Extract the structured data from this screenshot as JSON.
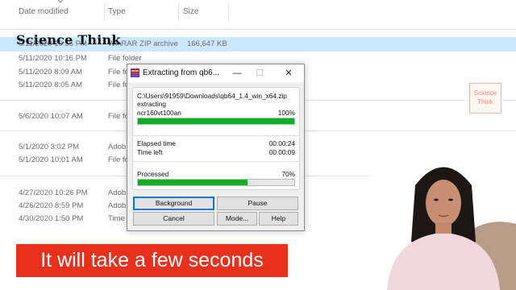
{
  "explorer": {
    "columns": {
      "date": "Date modified",
      "type": "Type",
      "size": "Size"
    },
    "rows": [
      {
        "date": "5/11/2020 10:55 PM",
        "type": "WinRAR ZIP archive",
        "size": "166,647 KB",
        "selected": true
      },
      {
        "date": "5/11/2020 10:16 PM",
        "type": "File folder",
        "size": ""
      },
      {
        "date": "5/11/2020 8:09 AM",
        "type": "File fo",
        "size": ""
      },
      {
        "date": "5/11/2020 8:05 AM",
        "type": "File fo",
        "size": ""
      },
      {
        "date": "5/6/2020 10:07 AM",
        "type": "File fo",
        "size": ""
      },
      {
        "date": "5/1/2020 3:02 PM",
        "type": "Adob",
        "size": ""
      },
      {
        "date": "5/1/2020 10:01 AM",
        "type": "File fo",
        "size": ""
      },
      {
        "date": "4/27/2020 10:26 PM",
        "type": "Adob",
        "size": ""
      },
      {
        "date": "4/26/2020 8:59 PM",
        "type": "Adob",
        "size": ""
      },
      {
        "date": "4/30/2020 1:50 PM",
        "type": "Time fo",
        "size": ""
      }
    ]
  },
  "watermark": {
    "brand": "Science Think",
    "logo_line1": "Science",
    "logo_line2": "Think"
  },
  "dialog": {
    "title": "Extracting from qb6...",
    "path": "C:\\Users\\91959\\Downloads\\qb64_1.4_win_x64.zip",
    "status": "extracting",
    "file": "ncr160vt100an",
    "file_percent_label": "100%",
    "file_progress": 1.0,
    "elapsed_label": "Elapsed time",
    "elapsed": "00:00:24",
    "left_label": "Time left",
    "time_left": "00:00:09",
    "processed_label": "Processed",
    "processed_percent_label": "70%",
    "processed_progress": 0.7,
    "buttons": {
      "background": "Background",
      "pause": "Pause",
      "cancel": "Cancel",
      "mode": "Mode...",
      "help": "Help"
    },
    "controls": {
      "minimize": "—",
      "maximize": "☐",
      "close": "✕"
    }
  },
  "caption": {
    "text": "It will take a few seconds"
  },
  "colors": {
    "progress": "#06b025",
    "caption_bg": "#e8301c",
    "selection": "#cce8ff"
  }
}
